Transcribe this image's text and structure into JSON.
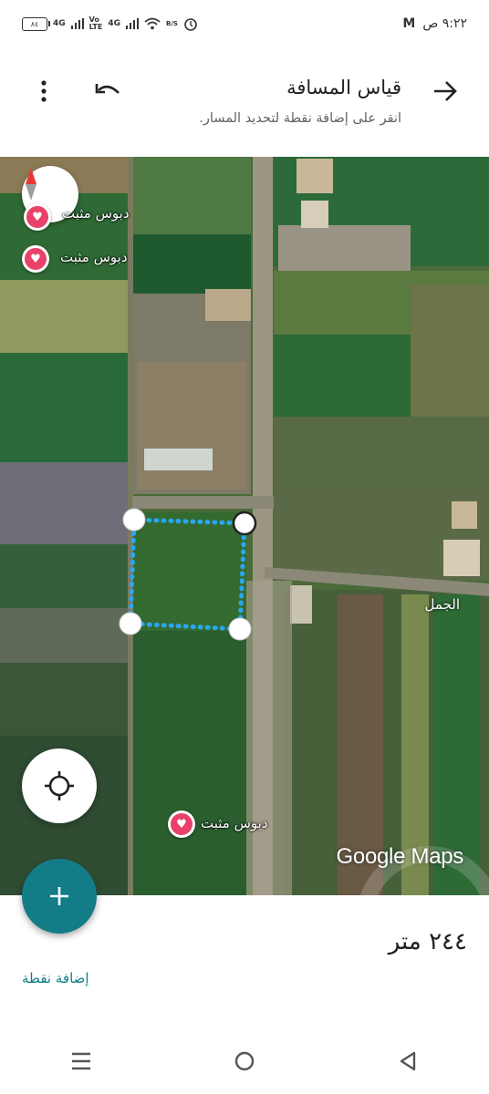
{
  "status_bar": {
    "time": "٩:٢٢ ص",
    "battery": "٨٤",
    "net1": "4G",
    "volte": "Vo\nLTE",
    "net2": "4G",
    "speed": "B/S"
  },
  "header": {
    "title": "قياس المسافة",
    "subtitle": "انقر على إضافة نقطة لتحديد المسار.",
    "back_icon": "arrow-right-icon",
    "undo_icon": "undo-icon",
    "menu_icon": "more-vert-icon"
  },
  "map": {
    "pins": [
      {
        "label": "دبوس مثبت"
      },
      {
        "label": "دبوس مثبت"
      },
      {
        "label": "دبوس مثبت"
      }
    ],
    "road_label": "الجمل",
    "watermark": "Google Maps",
    "measure_color": "#2aa6f0"
  },
  "measure": {
    "distance": "٢٤٤ متر",
    "add_point": "إضافة نقطة"
  },
  "colors": {
    "accent": "#137c87",
    "pin": "#e8416a"
  }
}
